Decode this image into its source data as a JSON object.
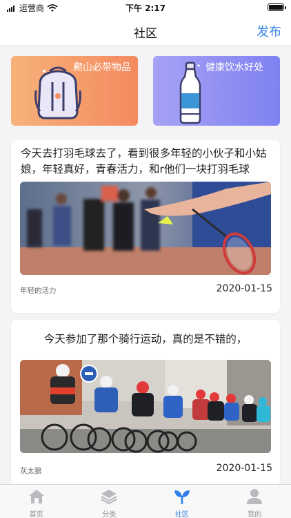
{
  "status_bar": {
    "carrier": "运营商",
    "time": "下午 2:17"
  },
  "nav": {
    "title": "社区",
    "action": "发布",
    "accent": "#3a86e6"
  },
  "banners": [
    {
      "label": "爬山必带物品",
      "icon": "backpack-icon",
      "colors": [
        "#f7b27a",
        "#f48a5f"
      ]
    },
    {
      "label": "健康饮水好处",
      "icon": "water-bottle-icon",
      "colors": [
        "#a6a2f4",
        "#7f82f2"
      ]
    }
  ],
  "posts": [
    {
      "text": "今天去打羽毛球去了，看到很多年轻的小伙子和小姑娘，年轻真好，青春活力，和r他们一块打羽毛球",
      "image": "badminton-photo",
      "tag": "年轻的活力",
      "date": "2020-01-15"
    },
    {
      "text": "今天参加了那个骑行运动，真的是不错的，",
      "image": "cycling-race-photo",
      "tag": "灰太狼",
      "date": "2020-01-15"
    }
  ],
  "tabs": [
    {
      "label": "首页",
      "icon": "home-icon",
      "active": false
    },
    {
      "label": "分类",
      "icon": "layers-icon",
      "active": false
    },
    {
      "label": "社区",
      "icon": "sprout-icon",
      "active": true
    },
    {
      "label": "我的",
      "icon": "user-icon",
      "active": false
    }
  ]
}
